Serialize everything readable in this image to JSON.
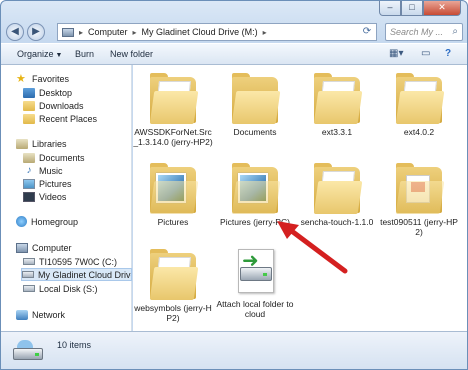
{
  "titlebar": {
    "minimize_glyph": "–",
    "maximize_glyph": "□",
    "close_glyph": "✕"
  },
  "address": {
    "crumbs": [
      "Computer",
      "My Gladinet Cloud Drive (M:)"
    ],
    "search_placeholder": "Search My ...",
    "back_icon": "back-arrow-icon",
    "forward_icon": "forward-arrow-icon"
  },
  "toolbar": {
    "organize": "Organize",
    "burn": "Burn",
    "new_folder": "New folder"
  },
  "nav": {
    "favorites": "Favorites",
    "desktop": "Desktop",
    "downloads": "Downloads",
    "recent_places": "Recent Places",
    "libraries": "Libraries",
    "documents": "Documents",
    "music": "Music",
    "pictures": "Pictures",
    "videos": "Videos",
    "homegroup": "Homegroup",
    "computer": "Computer",
    "drive_c": "TI10595 7W0C (C:)",
    "drive_m": "My Gladinet Cloud Drive (M",
    "drive_s": "Local Disk (S:)",
    "network": "Network"
  },
  "items": [
    {
      "label": "AWSSDKForNet.Src_1.3.14.0 (jerry-HP2)",
      "kind": "folder"
    },
    {
      "label": "Documents",
      "kind": "folder"
    },
    {
      "label": "ext3.3.1",
      "kind": "folder"
    },
    {
      "label": "ext4.0.2",
      "kind": "folder"
    },
    {
      "label": "Pictures",
      "kind": "picture-folder"
    },
    {
      "label": "Pictures (jerry-PC)",
      "kind": "picture-folder"
    },
    {
      "label": "sencha-touch-1.1.0",
      "kind": "folder"
    },
    {
      "label": "test090511 (jerry-HP2)",
      "kind": "doc-folder"
    },
    {
      "label": "websymbols (jerry-HP2)",
      "kind": "folder"
    },
    {
      "label": "Attach local folder to cloud",
      "kind": "attach"
    }
  ],
  "details": {
    "count": "10 items"
  },
  "colors": {
    "annotation_arrow": "#d42020",
    "selection": "#d9e8f7"
  }
}
